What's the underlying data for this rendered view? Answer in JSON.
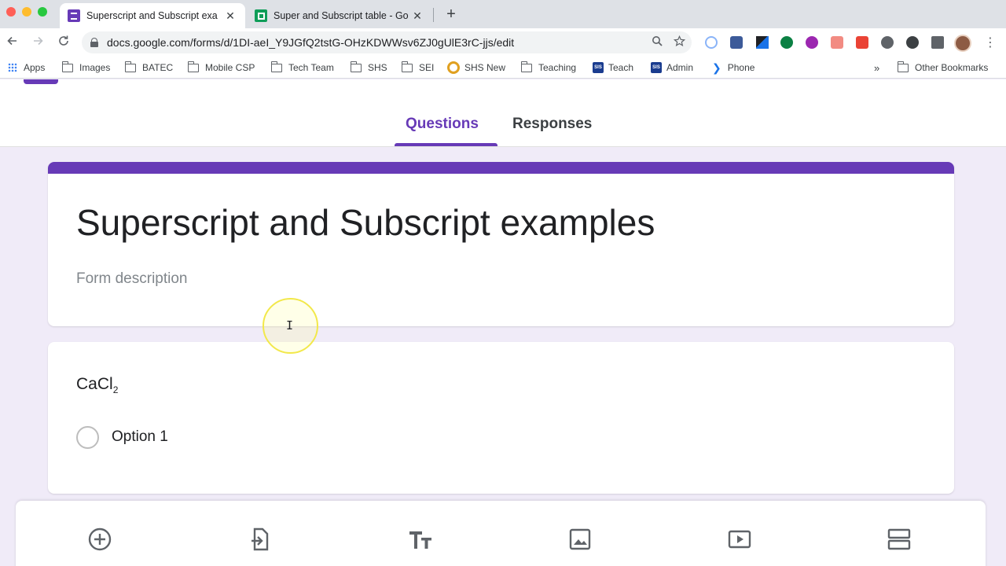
{
  "browser": {
    "tabs": [
      {
        "title": "Superscript and Subscript exa",
        "active": true,
        "favicon": "google-forms-icon"
      },
      {
        "title": "Super and Subscript table - Go",
        "active": false,
        "favicon": "google-sheets-icon"
      }
    ],
    "close_glyph": "✕",
    "new_tab_glyph": "+",
    "url": "docs.google.com/forms/d/1DI-aeI_Y9JGfQ2tstG-OHzKDWWsv6ZJ0gUlE3rC-jjs/edit",
    "bookmarks": [
      {
        "label": "Apps",
        "icon": "apps-grid-icon"
      },
      {
        "label": "Images",
        "icon": "folder-icon"
      },
      {
        "label": "BATEC",
        "icon": "folder-icon"
      },
      {
        "label": "Mobile CSP",
        "icon": "folder-icon"
      },
      {
        "label": "Tech Team",
        "icon": "folder-icon"
      },
      {
        "label": "SHS",
        "icon": "folder-icon"
      },
      {
        "label": "SEI",
        "icon": "folder-icon"
      },
      {
        "label": "SHS New",
        "icon": "shs-logo-icon"
      },
      {
        "label": "Teaching",
        "icon": "folder-icon"
      },
      {
        "label": "Teach",
        "icon": "sis-icon"
      },
      {
        "label": "Admin",
        "icon": "sis-icon"
      },
      {
        "label": "Phone",
        "icon": "chevron-icon"
      }
    ],
    "bookmarks_overflow": "»",
    "other_bookmarks": "Other Bookmarks",
    "sis_text": "SIS"
  },
  "form": {
    "tabs": {
      "questions": "Questions",
      "responses": "Responses"
    },
    "title": "Superscript and Subscript examples",
    "description_placeholder": "Form description",
    "question": {
      "base": "CaCl",
      "subscript": "2"
    },
    "option_1": "Option 1"
  },
  "colors": {
    "accent": "#673ab7",
    "background": "#f0ebf8"
  },
  "bottom_tools": [
    "add-question-icon",
    "import-questions-icon",
    "add-title-icon",
    "add-image-icon",
    "add-video-icon",
    "add-section-icon"
  ]
}
